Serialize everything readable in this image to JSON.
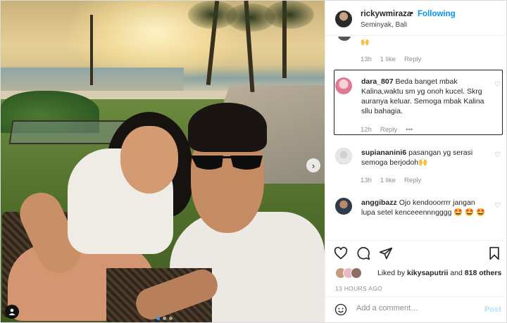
{
  "header": {
    "username": "rickywmiraza",
    "separator": "•",
    "follow_label": "Following",
    "location": "Seminyak, Bali"
  },
  "comments": [
    {
      "emoji": "🙌",
      "age": "13h",
      "likes": "1 like",
      "reply_label": "Reply"
    },
    {
      "username": "dara_807",
      "text": "Beda banget mbak Kalina,waktu sm yg onoh kucel. Skrg auranya keluar. Semoga mbak Kalina sllu bahagia.",
      "age": "12h",
      "reply_label": "Reply",
      "more": "•••"
    },
    {
      "username": "supiananini6",
      "text": "pasangan yg serasi semoga berjodoh🙌",
      "age": "13h",
      "likes": "1 like",
      "reply_label": "Reply"
    },
    {
      "username": "anggibazz",
      "text": "Ojo kendooorrrr jangan lupa setel kenceeennngggg 🤩 🤩 🤩"
    }
  ],
  "likes": {
    "prefix": "Liked by",
    "user": "kikysaputrii",
    "and": "and",
    "others": "818 others"
  },
  "timestamp": "13 HOURS AGO",
  "add_comment": {
    "placeholder": "Add a comment…",
    "post_label": "Post"
  },
  "icons": [
    "heart-icon",
    "comment-icon",
    "share-icon",
    "bookmark-icon",
    "emoji-icon",
    "chevron-right-icon",
    "user-tag-icon"
  ],
  "colors": {
    "accent": "#0095f6",
    "post_disabled": "#b2dffc",
    "meta_gray": "#8e8e8e"
  }
}
